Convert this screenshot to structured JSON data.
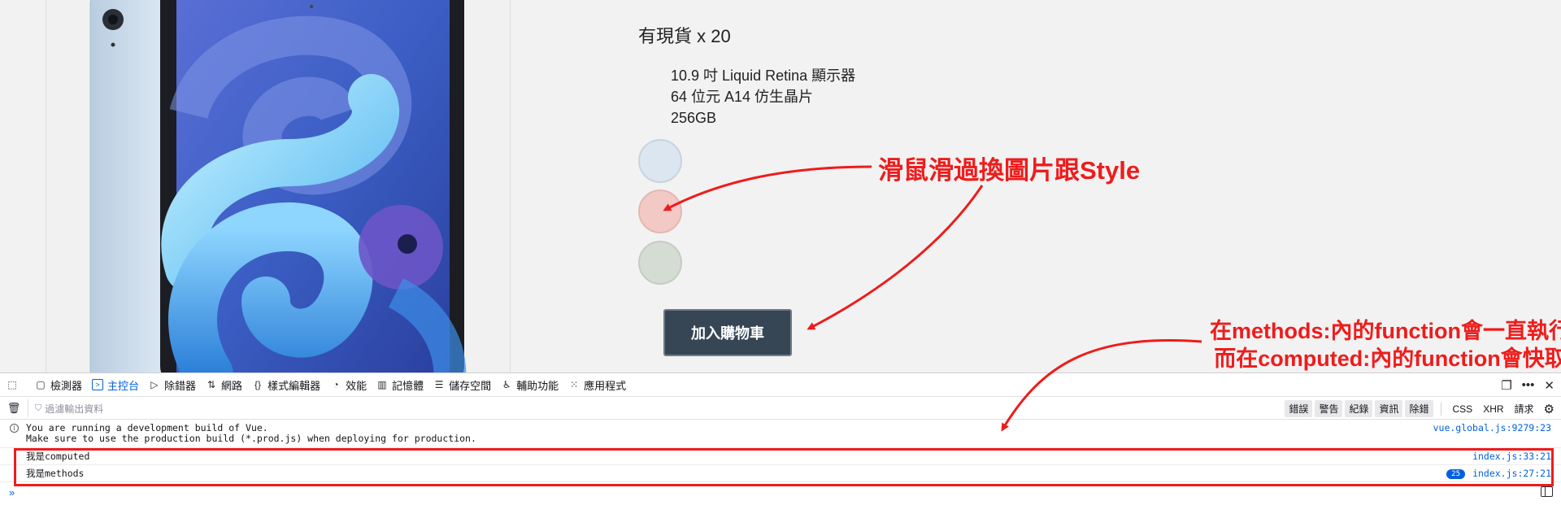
{
  "product": {
    "stock": "有現貨 x 20",
    "specs": [
      "10.9 吋 Liquid Retina 顯示器",
      "64 位元 A14 仿生晶片",
      "256GB"
    ],
    "swatches": [
      "sky-blue",
      "rose-gold",
      "green"
    ],
    "add_to_cart": "加入購物車",
    "image": "ipad-air-image"
  },
  "annotations": {
    "hover_note": "滑鼠滑過換圖片跟Style",
    "methods_note_line1": "在methods:內的function會一直執行",
    "methods_note_line2": "而在computed:內的function會快取"
  },
  "devtools": {
    "tabs": [
      {
        "label": "檢測器",
        "icon": "inspector-icon"
      },
      {
        "label": "主控台",
        "icon": "console-icon",
        "active": true
      },
      {
        "label": "除錯器",
        "icon": "debugger-icon"
      },
      {
        "label": "網路",
        "icon": "network-icon"
      },
      {
        "label": "樣式編輯器",
        "icon": "style-editor-icon"
      },
      {
        "label": "效能",
        "icon": "performance-icon"
      },
      {
        "label": "記憶體",
        "icon": "memory-icon"
      },
      {
        "label": "儲存空間",
        "icon": "storage-icon"
      },
      {
        "label": "輔助功能",
        "icon": "accessibility-icon"
      },
      {
        "label": "應用程式",
        "icon": "application-icon"
      }
    ],
    "filter_placeholder": "過濾輸出資料",
    "levels": [
      "錯誤",
      "警告",
      "紀錄",
      "資訊",
      "除錯"
    ],
    "extra_filters": [
      "CSS",
      "XHR",
      "請求"
    ],
    "messages": [
      {
        "text_line1": "You are running a development build of Vue.",
        "text_line2": "Make sure to use the production build (*.prod.js) when deploying for production.",
        "source": "vue.global.js:9279:23"
      },
      {
        "text": "我是computed",
        "source": "index.js:33:21"
      },
      {
        "text": "我是methods",
        "source": "index.js:27:21",
        "count": "25"
      }
    ]
  },
  "colors": {
    "annotation_red": "#ee1c1c",
    "devtools_accent": "#0061e0",
    "cart_button": "#364655"
  }
}
